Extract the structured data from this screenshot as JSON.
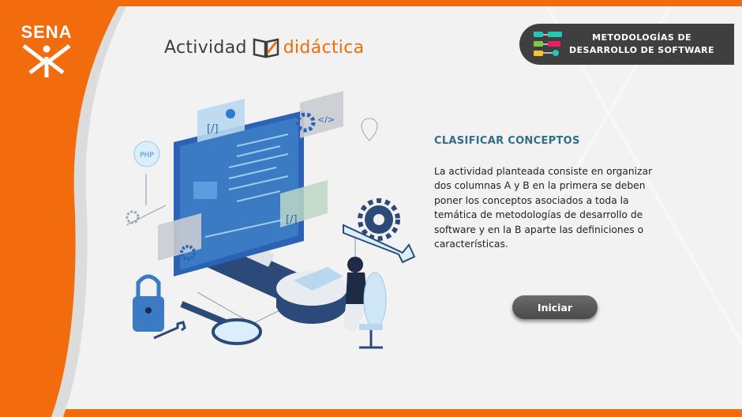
{
  "brand": {
    "logo_text": "SENA"
  },
  "header": {
    "title_part1": "Actividad",
    "title_part2": "didáctica",
    "badge_line1": "METODOLOGÍAS DE",
    "badge_line2": "DESARROLLO DE SOFTWARE"
  },
  "main": {
    "section_title": "CLASIFICAR CONCEPTOS",
    "description": "La actividad planteada consiste en organizar dos columnas A y B en la primera se deben poner los conceptos asociados a toda la temática de metodologías de desarrollo de software y en la B aparte las definiciones o características.",
    "start_button": "Iniciar"
  },
  "illustration": {
    "php_label": "PHP",
    "code_tag": "</>",
    "slash_tag": "[/]"
  },
  "colors": {
    "accent": "#f26c0e",
    "title_blue": "#2f6d8a",
    "badge_bg": "#3f3f3f",
    "illustration_blue": "#3a7bc4"
  }
}
